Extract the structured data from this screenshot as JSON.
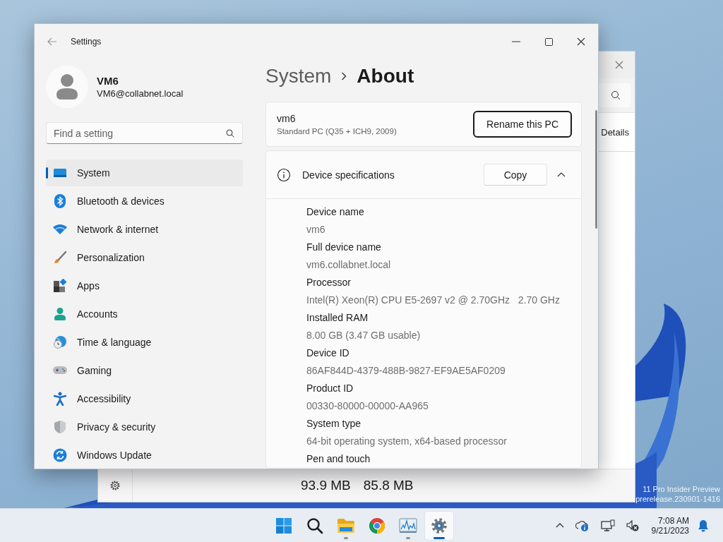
{
  "desktop": {
    "watermark": [
      "11 Pro Insider Preview",
      "prerelease.230901-1416"
    ]
  },
  "background_window": {
    "tab": "Details",
    "values": [
      "93.9 MB",
      "85.8 MB"
    ]
  },
  "settings": {
    "title": "Settings",
    "user": {
      "name": "VM6",
      "email": "VM6@collabnet.local"
    },
    "search": {
      "placeholder": "Find a setting"
    },
    "nav": [
      {
        "label": "System",
        "selected": true
      },
      {
        "label": "Bluetooth & devices",
        "selected": false
      },
      {
        "label": "Network & internet",
        "selected": false
      },
      {
        "label": "Personalization",
        "selected": false
      },
      {
        "label": "Apps",
        "selected": false
      },
      {
        "label": "Accounts",
        "selected": false
      },
      {
        "label": "Time & language",
        "selected": false
      },
      {
        "label": "Gaming",
        "selected": false
      },
      {
        "label": "Accessibility",
        "selected": false
      },
      {
        "label": "Privacy & security",
        "selected": false
      },
      {
        "label": "Windows Update",
        "selected": false
      }
    ],
    "breadcrumb": {
      "parent": "System",
      "current": "About"
    },
    "device": {
      "name": "vm6",
      "model": "Standard PC (Q35 + ICH9, 2009)",
      "button": "Rename this PC"
    },
    "specs": {
      "title": "Device specifications",
      "button": "Copy",
      "expanded": true,
      "items": [
        {
          "label": "Device name",
          "value": "vm6"
        },
        {
          "label": "Full device name",
          "value": "vm6.collabnet.local"
        },
        {
          "label": "Processor",
          "value": "Intel(R) Xeon(R) CPU E5-2697 v2 @ 2.70GHz   2.70 GHz"
        },
        {
          "label": "Installed RAM",
          "value": "8.00 GB (3.47 GB usable)"
        },
        {
          "label": "Device ID",
          "value": "86AF844D-4379-488B-9827-EF9AE5AF0209"
        },
        {
          "label": "Product ID",
          "value": "00330-80000-00000-AA965"
        },
        {
          "label": "System type",
          "value": "64-bit operating system, x64-based processor"
        },
        {
          "label": "Pen and touch"
        }
      ]
    }
  },
  "taskbar": {
    "apps": [
      {
        "running": false,
        "selected": false
      },
      {
        "running": false,
        "selected": false
      },
      {
        "running": true,
        "selected": false
      },
      {
        "running": false,
        "selected": false
      },
      {
        "running": true,
        "selected": false
      },
      {
        "running": true,
        "selected": true
      }
    ],
    "clock": {
      "time": "7:08 AM",
      "date": "9/21/2023"
    }
  }
}
